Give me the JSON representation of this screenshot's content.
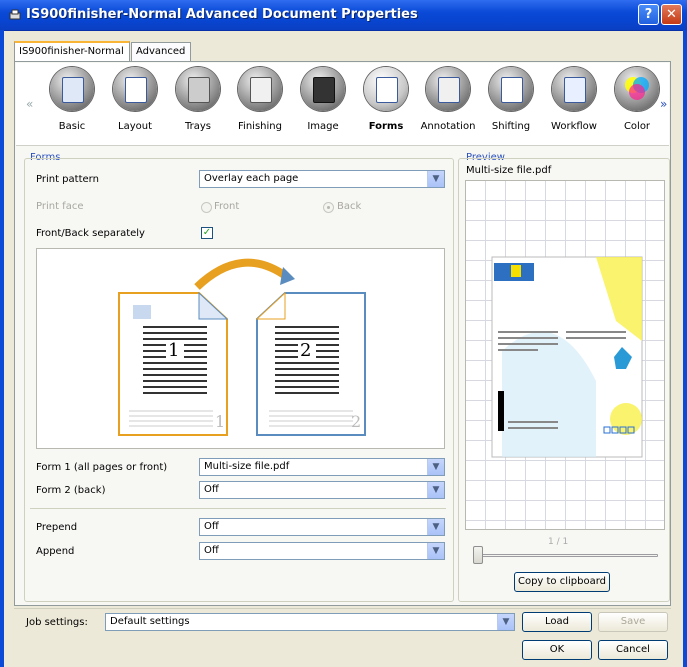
{
  "window": {
    "title": "IS900finisher-Normal Advanced Document Properties",
    "help_glyph": "?",
    "close_glyph": "✕"
  },
  "tabs": [
    {
      "label": "IS900finisher-Normal"
    },
    {
      "label": "Advanced"
    }
  ],
  "iconbar": {
    "items": [
      {
        "label": "Basic",
        "icon": "basic-icon"
      },
      {
        "label": "Layout",
        "icon": "layout-icon"
      },
      {
        "label": "Trays",
        "icon": "trays-icon"
      },
      {
        "label": "Finishing",
        "icon": "finishing-icon"
      },
      {
        "label": "Image",
        "icon": "image-icon"
      },
      {
        "label": "Forms",
        "icon": "forms-icon",
        "selected": true
      },
      {
        "label": "Annotation",
        "icon": "annotation-icon"
      },
      {
        "label": "Shifting",
        "icon": "shifting-icon"
      },
      {
        "label": "Workflow",
        "icon": "workflow-icon"
      },
      {
        "label": "Color",
        "icon": "color-icon"
      }
    ],
    "left_arrow": "«",
    "right_arrow": "»"
  },
  "forms": {
    "group_label": "Forms",
    "print_pattern": {
      "label": "Print pattern",
      "value": "Overlay each page"
    },
    "print_face": {
      "label": "Print face",
      "front": "Front",
      "back": "Back",
      "selected": "Back"
    },
    "front_back_separately": {
      "label": "Front/Back separately",
      "checked": true
    },
    "illustration": {
      "page1": "1",
      "page2": "2",
      "corner1": "1",
      "corner2": "2"
    },
    "form1": {
      "label": "Form 1 (all pages or front)",
      "value": "Multi-size file.pdf"
    },
    "form2": {
      "label": "Form 2 (back)",
      "value": "Off"
    },
    "prepend": {
      "label": "Prepend",
      "value": "Off"
    },
    "append": {
      "label": "Append",
      "value": "Off"
    }
  },
  "preview": {
    "group_label": "Preview",
    "filename": "Multi-size file.pdf",
    "page_indicator": "1 / 1",
    "copy_button": "Copy to clipboard"
  },
  "footer": {
    "job_settings_label": "Job settings:",
    "job_settings_value": "Default settings",
    "load_button": "Load",
    "save_button": "Save",
    "ok_button": "OK",
    "cancel_button": "Cancel"
  },
  "colors": {
    "title_bar": "#0a4ad6",
    "group_label": "#2a52be",
    "accent_orange": "#e8a020",
    "accent_blue": "#5b8cc0"
  }
}
